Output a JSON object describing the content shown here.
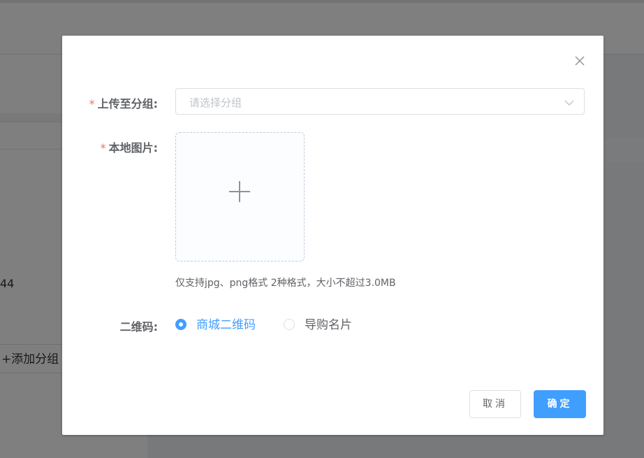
{
  "background": {
    "count_fragment": "44",
    "add_group_label": "+添加分组"
  },
  "dialog": {
    "fields": {
      "group": {
        "label": "上传至分组:",
        "required_mark": "*",
        "placeholder": "请选择分组"
      },
      "image": {
        "label": "本地图片:",
        "required_mark": "*",
        "tip": "仅支持jpg、png格式 2种格式，大小不超过3.0MB"
      },
      "qrcode": {
        "label": "二维码:",
        "options": [
          {
            "label": "商城二维码",
            "checked": true
          },
          {
            "label": "导购名片",
            "checked": false
          }
        ]
      }
    },
    "buttons": {
      "cancel": "取消",
      "confirm": "确定"
    }
  },
  "colors": {
    "primary": "#409eff",
    "required": "#f56c6c",
    "placeholder": "#c0c4cc",
    "text": "#606266"
  },
  "icons": {
    "close": "close-icon",
    "arrow": "chevron-down-icon",
    "upload": "plus-icon"
  }
}
